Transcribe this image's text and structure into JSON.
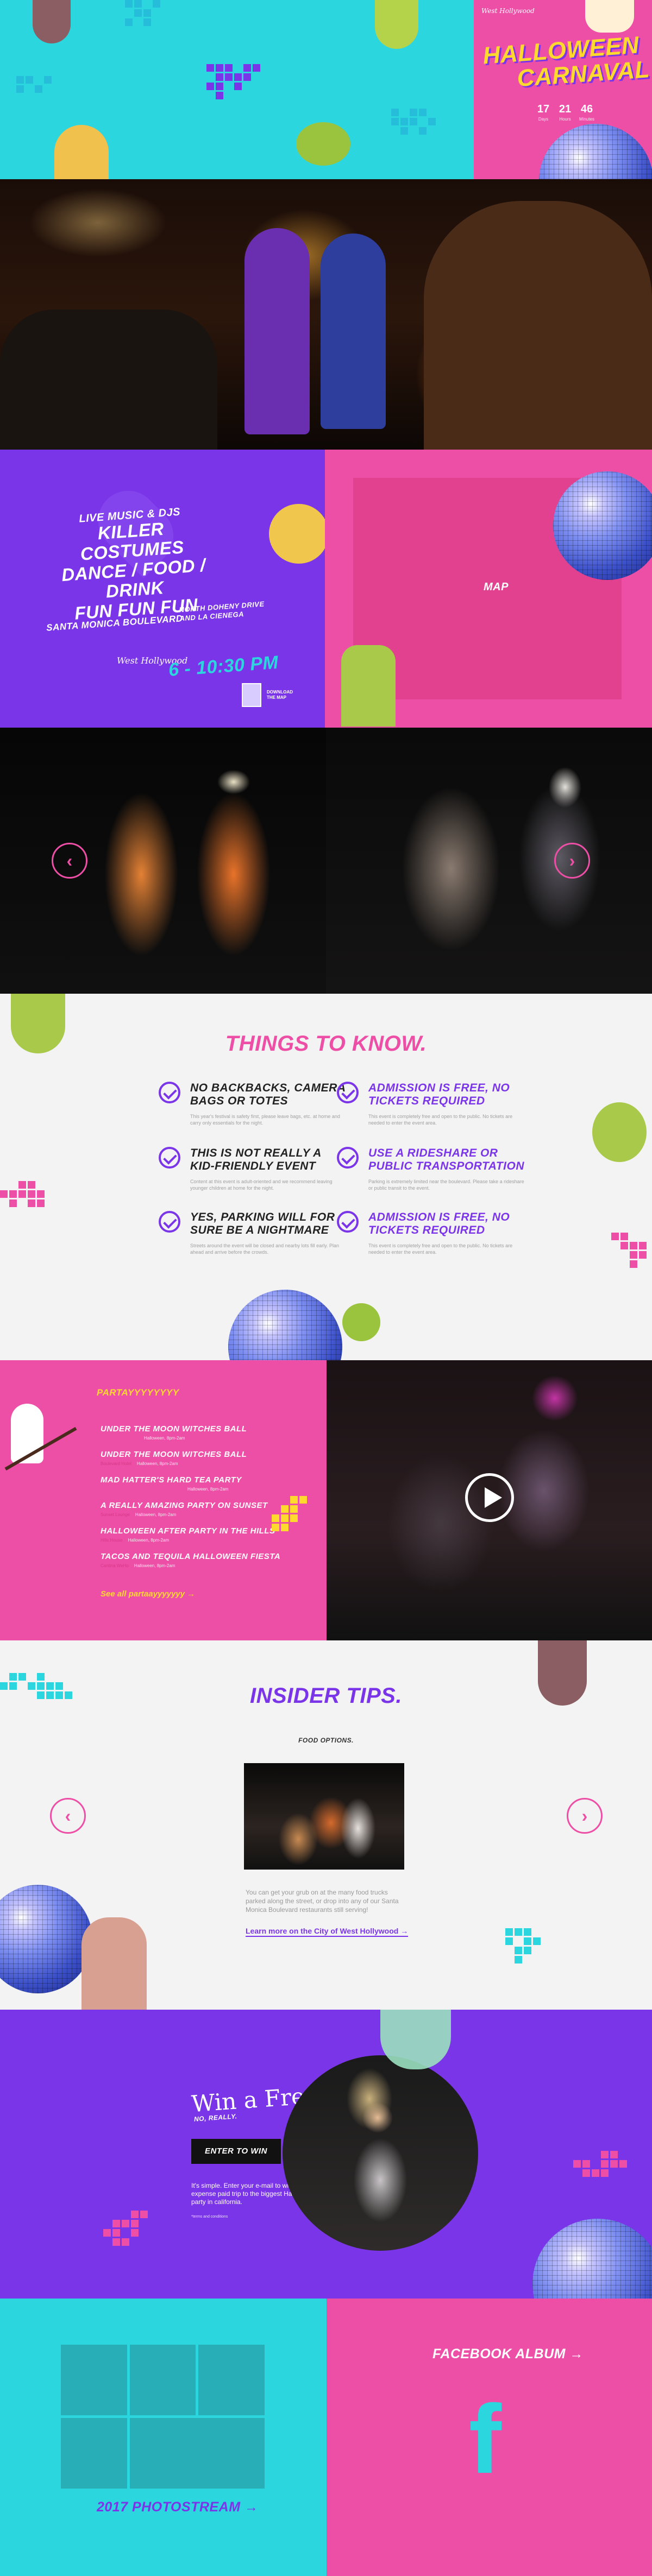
{
  "colors": {
    "cyan": "#2cd6df",
    "pink": "#ee4fa6",
    "purple": "#7b35e8",
    "yellow": "#ffd92e",
    "light": "#f3f3f3"
  },
  "hero": {
    "logo": "West Hollywood",
    "title_line1": "HALLOWEEN",
    "title_line2": "CARNAVAL",
    "dates": [
      {
        "num": "17",
        "label": "Days"
      },
      {
        "num": "21",
        "label": "Hours"
      },
      {
        "num": "46",
        "label": "Minutes"
      }
    ]
  },
  "info": {
    "lines": [
      {
        "text": "Live Music & DJs",
        "size": "small"
      },
      {
        "text": "Killer Costumes",
        "size": "big"
      },
      {
        "text": "Dance / Food / Drink",
        "size": "big"
      },
      {
        "text": "Fun Fun Fun",
        "size": "big"
      }
    ],
    "boulevard": "Santa Monica Boulevard",
    "cross_streets_1": "North Doheny Drive",
    "cross_streets_2": "and La Cienega",
    "time": "6 - 10:30 PM",
    "download_label": "Download the map",
    "logo": "West Hollywood",
    "map_label": "MAP"
  },
  "gallery": {
    "prev_icon": "chevron-left-icon",
    "next_icon": "chevron-right-icon"
  },
  "know": {
    "title": "THINGS TO KNOW.",
    "items": [
      {
        "title": "No backbacks, camera bags or totes",
        "desc": "This year's festival is safety first, please leave bags, etc. at home and carry only essentials for the night.",
        "color": "#111111"
      },
      {
        "title": "Admission is free, no tickets required",
        "desc": "This event is completely free and open to the public. No tickets are needed to enter the event area.",
        "color": "#7b35e8"
      },
      {
        "title": "This is not really a kid-friendly event",
        "desc": "Content at this event is adult-oriented and we recommend leaving younger children at home for the night.",
        "color": "#111111"
      },
      {
        "title": "Use a rideshare or public transportation",
        "desc": "Parking is extremely limited near the boulevard. Please take a rideshare or public transit to the event.",
        "color": "#7b35e8"
      },
      {
        "title": "Yes, parking will for sure be a nightmare",
        "desc": "Streets around the event will be closed and nearby lots fill early. Plan ahead and arrive before the crowds.",
        "color": "#111111"
      },
      {
        "title": "Admission is free, no tickets required",
        "desc": "This event is completely free and open to the public. No tickets are needed to enter the event area.",
        "color": "#7b35e8"
      }
    ]
  },
  "party": {
    "heading": "PARTAYYYYYYYY",
    "items": [
      {
        "title": "Under the Moon Witches Ball",
        "tag": "",
        "date": "Halloween, 8pm-2am"
      },
      {
        "title": "Under the Moon Witches Ball",
        "tag": "Boulevard Hotel",
        "date": "Halloween, 8pm-2am"
      },
      {
        "title": "Mad Hatter's Hard Tea Party",
        "tag": "",
        "date": "Halloween, 8pm-2am"
      },
      {
        "title": "A Really Amazing Party on Sunset",
        "tag": "Sunset Lounge",
        "date": "Halloween, 8pm-2am"
      },
      {
        "title": "Halloween After Party in the Hills",
        "tag": "Hills House",
        "date": "Halloween, 8pm-2am"
      },
      {
        "title": "Tacos and Tequila Halloween Fiesta",
        "tag": "Cantina WeHo",
        "date": "Halloween, 8pm-2am"
      }
    ],
    "see_all": "See all partaayyyyyyy",
    "play_icon": "play-icon"
  },
  "insider": {
    "title": "INSIDER TIPS.",
    "category": "FOOD OPTIONS.",
    "text": "You can get your grub on at the many food trucks parked along the street, or drop into any of our Santa Monica Boulevard restaurants still serving!",
    "link": "Learn more on the City of West Hollywood"
  },
  "win": {
    "title": "Win a Free Trip!",
    "subtitle": "NO, REALLY.",
    "button": "ENTER TO WIN",
    "text": "It's simple. Enter your e-mail to win an all-expense paid trip to the biggest Halloween party in california.",
    "note": "*terms and conditions"
  },
  "footer": {
    "photostream": "2017 PHOTOSTREAM",
    "facebook": "FACEBOOK ALBUM",
    "fb_glyph": "f"
  }
}
